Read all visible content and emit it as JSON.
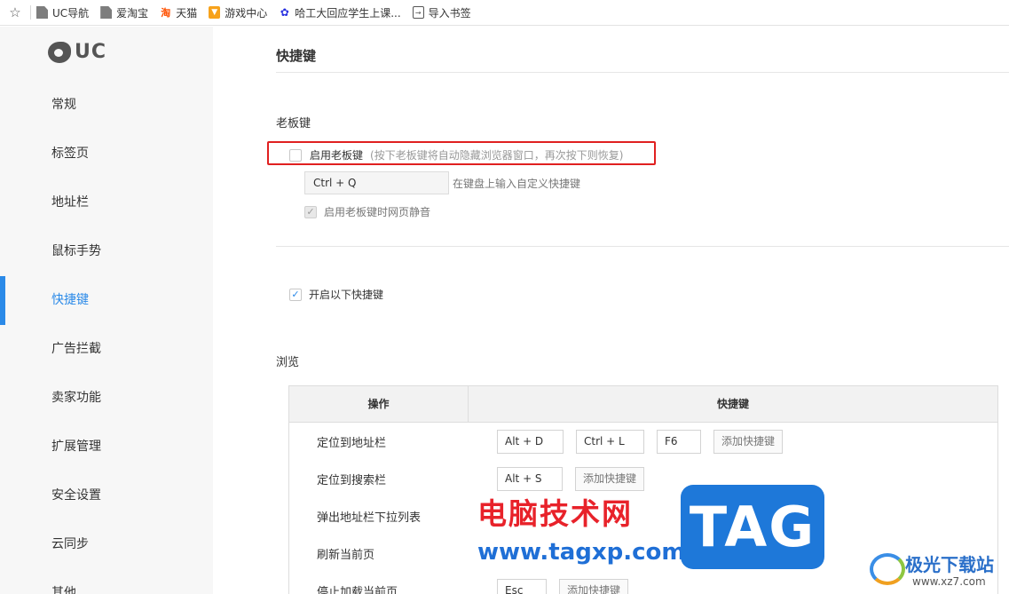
{
  "bookmarks": {
    "items": [
      {
        "label": "UC导航",
        "icon": "page-icon"
      },
      {
        "label": "爱淘宝",
        "icon": "page-icon"
      },
      {
        "label": "天猫",
        "icon": "taobao-icon"
      },
      {
        "label": "游戏中心",
        "icon": "game-center-icon"
      },
      {
        "label": "哈工大回应学生上课...",
        "icon": "baidu-paw-icon"
      },
      {
        "label": "导入书签",
        "icon": "import-icon"
      }
    ]
  },
  "sidebar": {
    "logo_text": "UC",
    "items": [
      {
        "label": "常规"
      },
      {
        "label": "标签页"
      },
      {
        "label": "地址栏"
      },
      {
        "label": "鼠标手势"
      },
      {
        "label": "快捷键"
      },
      {
        "label": "广告拦截"
      },
      {
        "label": "卖家功能"
      },
      {
        "label": "扩展管理"
      },
      {
        "label": "安全设置"
      },
      {
        "label": "云同步"
      },
      {
        "label": "其他"
      }
    ],
    "active_index": 4
  },
  "main": {
    "title": "快捷键",
    "boss_key": {
      "section_label": "老板键",
      "enable_label": "启用老板键",
      "enable_hint": "(按下老板键将自动隐藏浏览器窗口，再次按下则恢复)",
      "enable_checked": false,
      "key_value": "Ctrl + Q",
      "key_hint": "在键盘上输入自定义快捷键",
      "mute_label": "启用老板键时网页静音",
      "mute_checked": true
    },
    "enable_shortcuts_label": "开启以下快捷键",
    "enable_shortcuts_checked": true,
    "browse_label": "浏览",
    "table": {
      "col_action": "操作",
      "col_shortcut": "快捷键",
      "rows": [
        {
          "action": "定位到地址栏",
          "keys": [
            "Alt + D",
            "Ctrl + L",
            "F6"
          ],
          "add": "添加快捷键"
        },
        {
          "action": "定位到搜索栏",
          "keys": [
            "Alt + S"
          ],
          "add": "添加快捷键"
        },
        {
          "action": "弹出地址栏下拉列表",
          "keys": [],
          "add": ""
        },
        {
          "action": "刷新当前页",
          "keys": [],
          "add": ""
        },
        {
          "action": "停止加载当前页",
          "keys": [
            "Esc"
          ],
          "add": "添加快捷键"
        }
      ]
    }
  },
  "watermarks": {
    "cn": "电脑技术网",
    "url": "www.tagxp.com",
    "tag": "TAG",
    "site_cn": "极光下载站",
    "site_en": "www.xz7.com"
  },
  "colors": {
    "accent": "#2b8ae8",
    "highlight_border": "#e02020"
  }
}
